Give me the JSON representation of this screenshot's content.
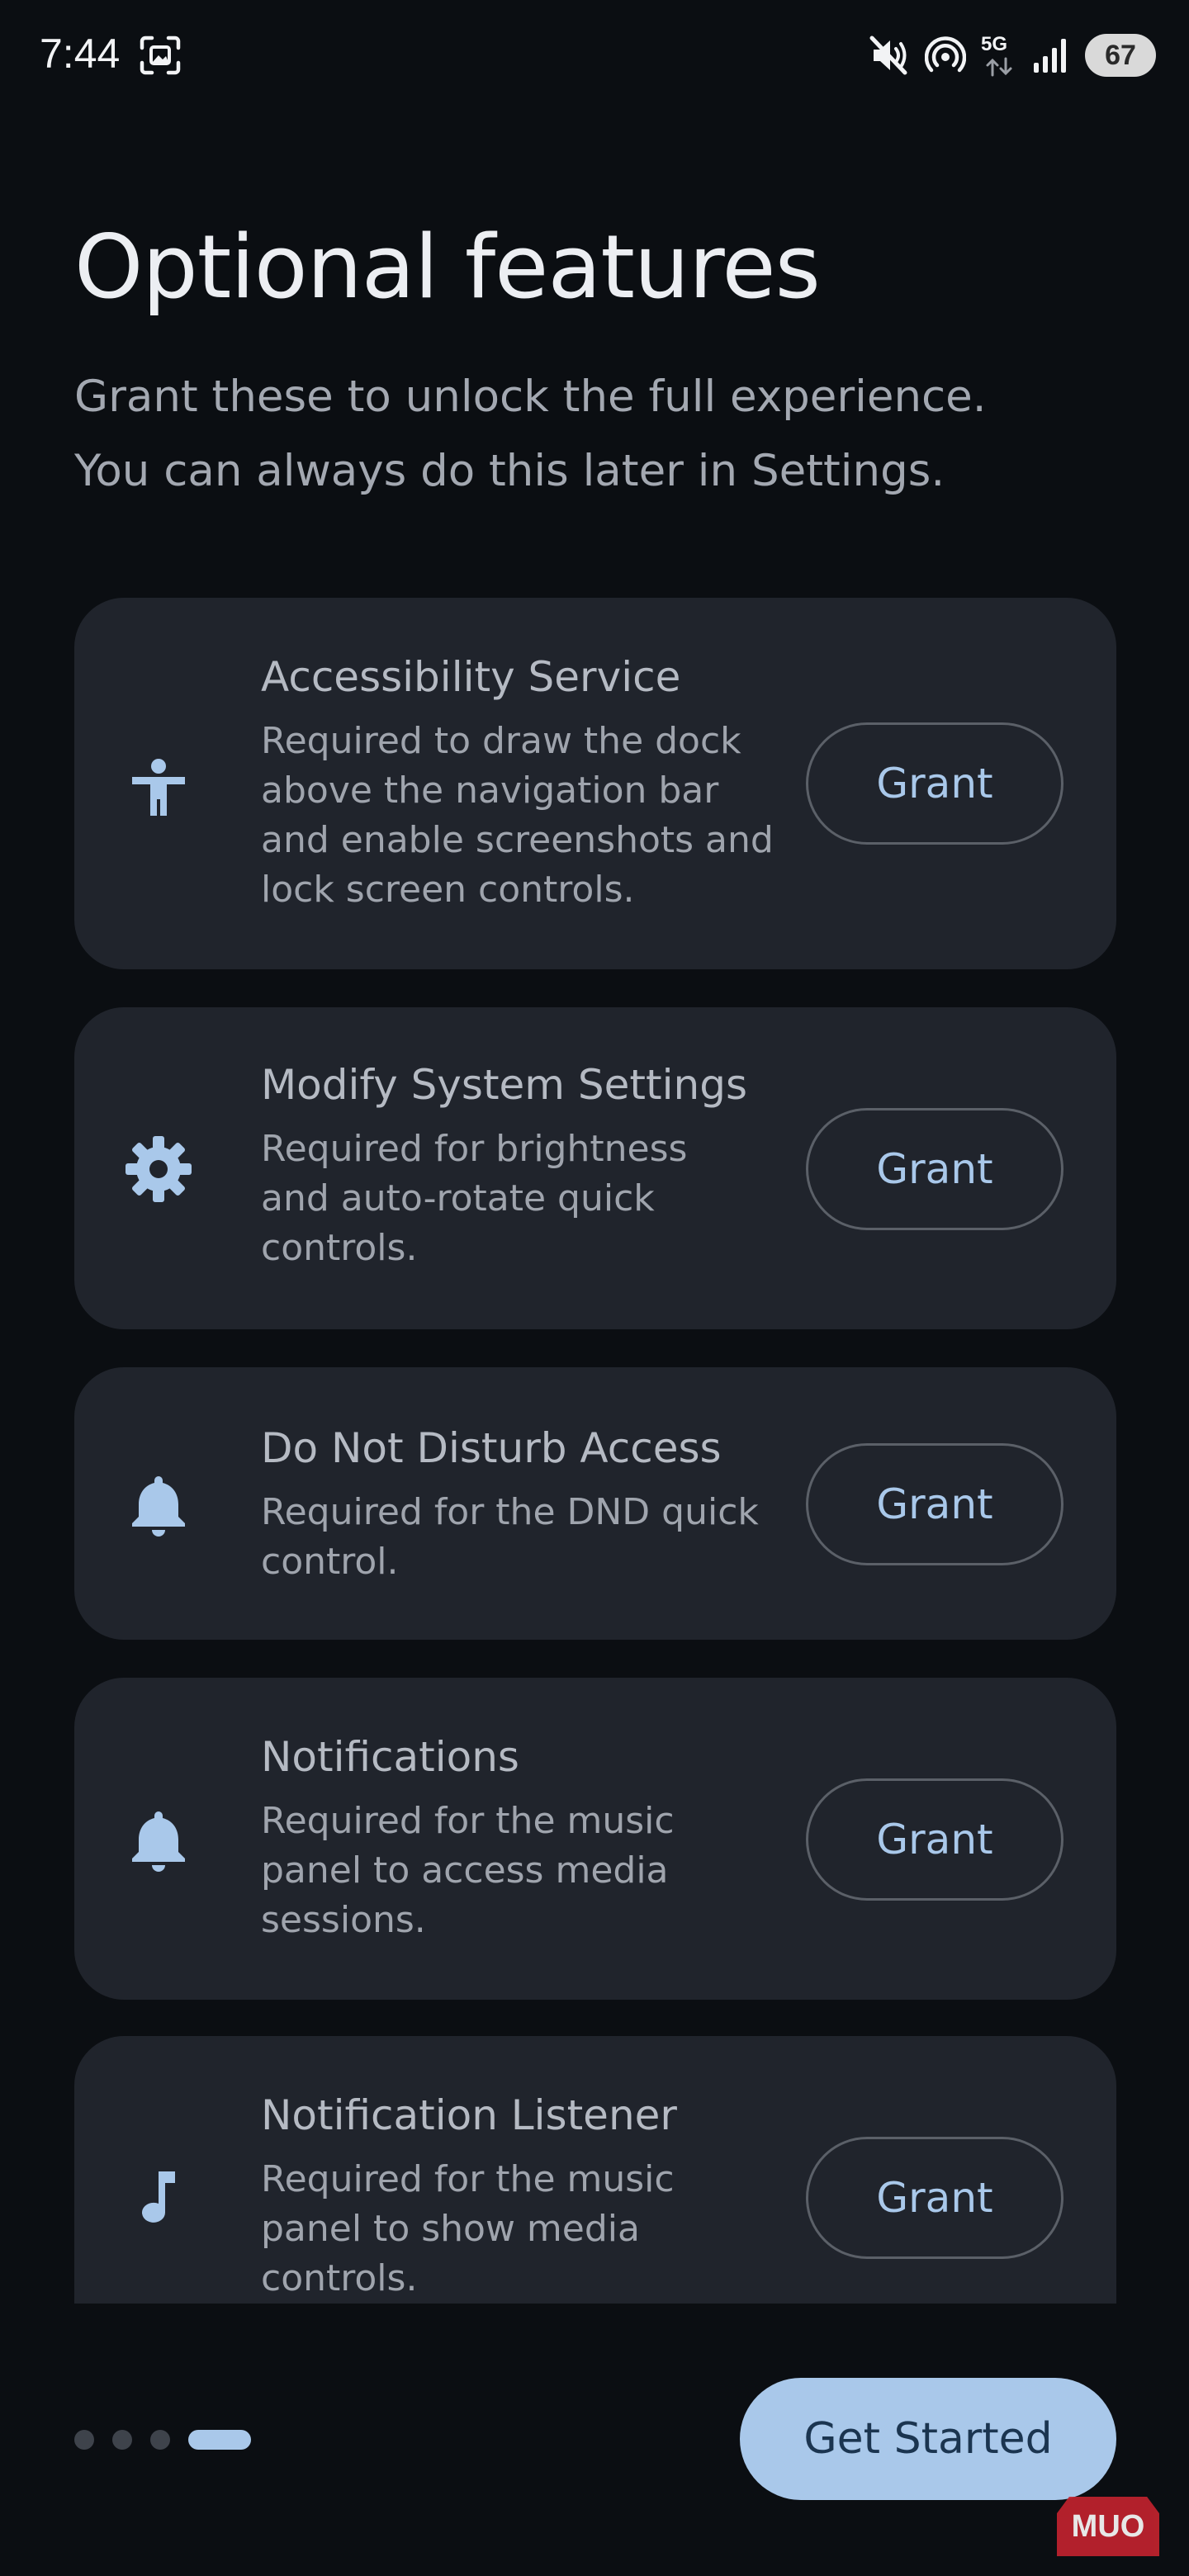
{
  "status_bar": {
    "time": "7:44",
    "network": "5G",
    "battery": "67",
    "icons": [
      "screenshot-icon",
      "mute-icon",
      "hotspot-icon",
      "5g-icon",
      "signal-icon",
      "battery-icon"
    ]
  },
  "header": {
    "title": "Optional features",
    "subtitle_lines": [
      "Grant these to unlock the full experience.",
      "You can always do this later in Settings."
    ]
  },
  "features": [
    {
      "icon": "accessibility-icon",
      "title": "Accessibility Service",
      "description_lines": [
        "Required to draw the dock",
        "above the navigation bar",
        "and enable screenshots and",
        "lock screen controls."
      ],
      "button_label": "Grant"
    },
    {
      "icon": "gear-icon",
      "title": "Modify System Settings",
      "description_lines": [
        "Required for brightness",
        "and auto-rotate quick",
        "controls."
      ],
      "button_label": "Grant"
    },
    {
      "icon": "bell-icon",
      "title": "Do Not Disturb Access",
      "description_lines": [
        "Required for the DND quick",
        "control."
      ],
      "button_label": "Grant"
    },
    {
      "icon": "bell-icon",
      "title": "Notifications",
      "description_lines": [
        "Required for the music",
        "panel to access media",
        "sessions."
      ],
      "button_label": "Grant"
    },
    {
      "icon": "music-note-icon",
      "title": "Notification Listener",
      "description_lines": [
        "Required for the music",
        "panel to show media",
        "controls."
      ],
      "button_label": "Grant"
    }
  ],
  "pager": {
    "page_count": 4,
    "current_page": 4
  },
  "footer": {
    "get_started_label": "Get Started"
  },
  "watermark": "MUO",
  "colors": {
    "background": "#0b0e12",
    "card": "#20242c",
    "accent": "#a9c8ea",
    "button_border": "#5b6068"
  }
}
